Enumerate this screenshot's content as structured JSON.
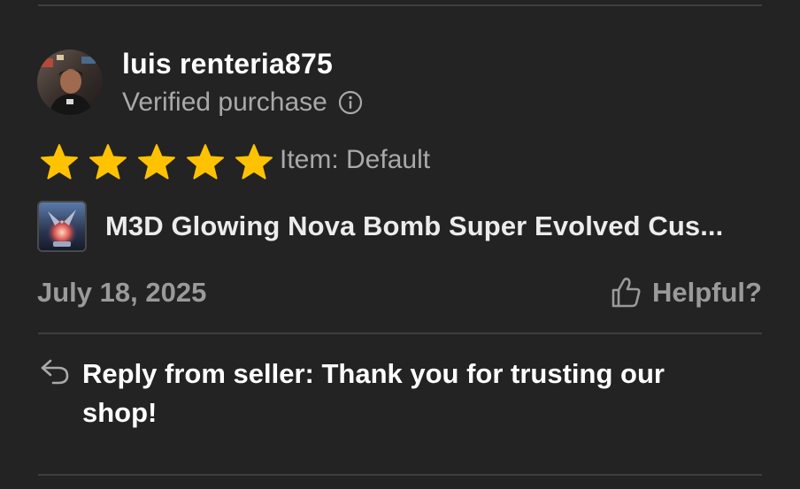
{
  "review": {
    "username": "luis renteria875",
    "verified_label": "Verified purchase",
    "rating": 5,
    "rating_max": 5,
    "item_variant": "Item: Default",
    "product_title": "M3D Glowing Nova Bomb Super Evolved Cus...",
    "date": "July 18, 2025",
    "helpful_label": "Helpful?",
    "seller_reply": "Reply from seller: Thank you for trusting our shop!"
  },
  "icons": {
    "verified_info": "info-icon",
    "rating": "star-icon",
    "helpful": "thumbs-up-icon",
    "reply": "reply-arrow-icon"
  },
  "colors": {
    "background": "#232323",
    "star": "#FFC200",
    "muted_text": "#A9A9A9",
    "divider": "#3E3E3E",
    "primary_text": "#FFFFFF"
  }
}
